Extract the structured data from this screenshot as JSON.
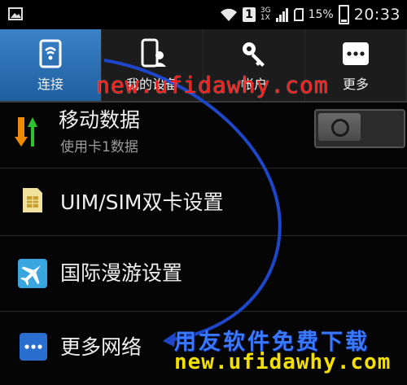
{
  "status_bar": {
    "sim_slot": "1",
    "network_top": "3G",
    "network_bottom": "1X",
    "battery_pct": "15%",
    "clock": "20:33"
  },
  "tabs": [
    {
      "label": "连接",
      "icon": "connection-icon",
      "active": true
    },
    {
      "label": "我的设备",
      "icon": "my-device-icon",
      "active": false
    },
    {
      "label": "帐户",
      "icon": "account-key-icon",
      "active": false
    },
    {
      "label": "更多",
      "icon": "more-dots-icon",
      "active": false
    }
  ],
  "rows": {
    "mobile_data": {
      "title": "移动数据",
      "subtitle": "使用卡1数据",
      "icon": "data-arrows-icon",
      "toggle_on": false
    },
    "dual_sim": {
      "title": "UIM/SIM双卡设置",
      "icon": "sim-card-icon"
    },
    "roaming": {
      "title": "国际漫游设置",
      "icon": "airplane-icon"
    },
    "more_networks": {
      "title": "更多网络",
      "icon": "more-dots-icon"
    }
  },
  "watermark": {
    "top": "new.ufidawhy.com",
    "cn": "用友软件免费下载",
    "bottom": "new.ufidawhy.com"
  },
  "colors": {
    "active_tab": "#2a6fb3",
    "watermark_red": "#ff1a1a",
    "watermark_blue": "#3a78ff",
    "watermark_yellow": "#f3e000",
    "arrow": "#1e46c8"
  }
}
